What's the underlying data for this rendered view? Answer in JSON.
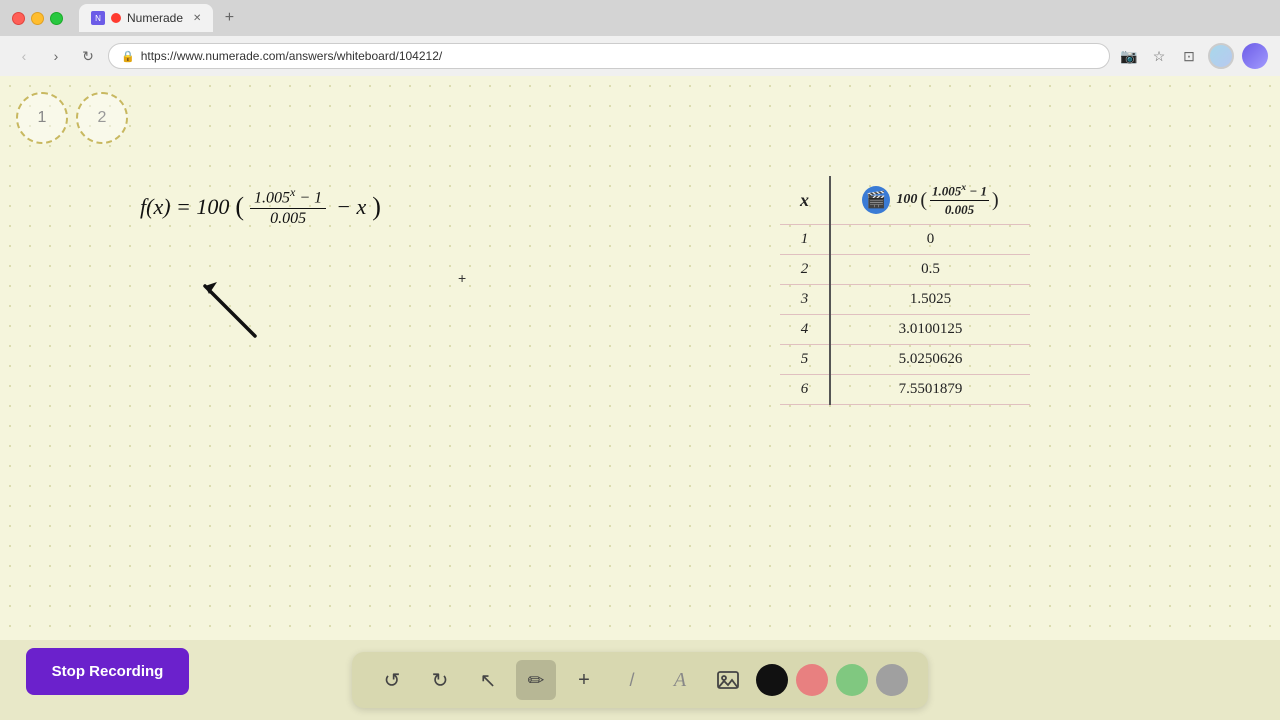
{
  "browser": {
    "tab_label": "Numerade",
    "url": "https://www.numerade.com/answers/whiteboard/104212/",
    "new_tab_label": "+"
  },
  "page_thumbnails": [
    {
      "label": "1"
    },
    {
      "label": "2"
    }
  ],
  "formula": {
    "left": "f(x) = 100",
    "numerator": "1.005ˣ − 1",
    "denominator": "0.005",
    "right": "− x",
    "plus_annotation": "+"
  },
  "table": {
    "col_x": "x",
    "col_formula_prefix": "100(",
    "col_formula_num": "1.005ˣ − 1",
    "col_formula_den": "0.005",
    "col_formula_suffix": ")",
    "rows": [
      {
        "x": "1",
        "value": "0"
      },
      {
        "x": "2",
        "value": "0.5"
      },
      {
        "x": "3",
        "value": "1.5025"
      },
      {
        "x": "4",
        "value": "3.0100125"
      },
      {
        "x": "5",
        "value": "5.0250626"
      },
      {
        "x": "6",
        "value": "7.5501879"
      }
    ]
  },
  "toolbar": {
    "undo_label": "↺",
    "redo_label": "↻",
    "select_label": "↖",
    "pencil_label": "✏",
    "add_label": "+",
    "eraser_label": "/",
    "text_label": "A",
    "image_label": "🖼",
    "colors": [
      "#111111",
      "#e88080",
      "#80c880",
      "#a0a0a0"
    ]
  },
  "stop_recording": {
    "label": "Stop Recording"
  }
}
